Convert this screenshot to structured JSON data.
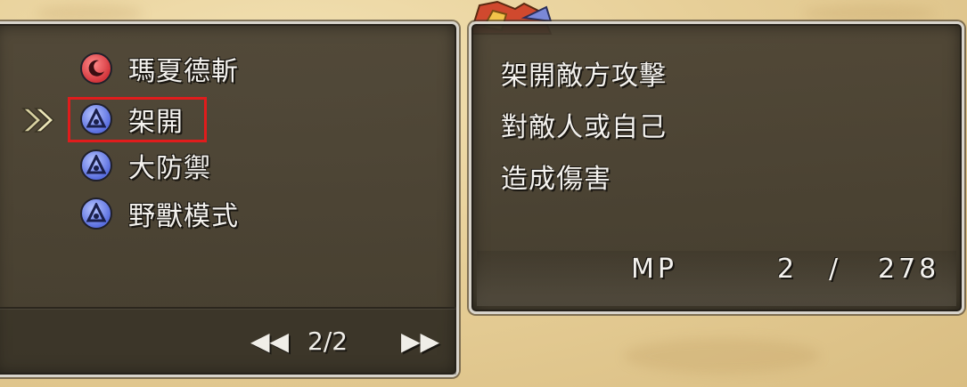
{
  "skills": [
    {
      "label": "瑪夏德斬",
      "icon": "crescent-moon-icon",
      "color": "#d4363c"
    },
    {
      "label": "架開",
      "icon": "drop-shield-icon",
      "color": "#5a6fe0"
    },
    {
      "label": "大防禦",
      "icon": "drop-shield-icon",
      "color": "#5a6fe0"
    },
    {
      "label": "野獸模式",
      "icon": "drop-shield-icon",
      "color": "#5a6fe0"
    }
  ],
  "selected_index": 1,
  "pager": {
    "current_total": "2/2",
    "prev": "◀◀",
    "next": "▶▶"
  },
  "description": {
    "lines": [
      "架開敵方攻擊",
      "對敵人或自己",
      "造成傷害"
    ]
  },
  "mp": {
    "label": "MP",
    "current": "2",
    "separator": "/",
    "max": "278"
  },
  "highlight_color": "#e01c1c"
}
